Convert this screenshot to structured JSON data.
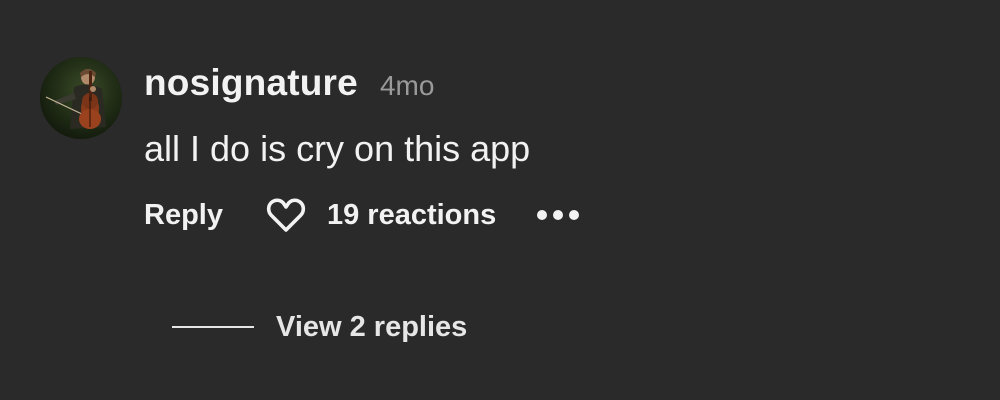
{
  "comment": {
    "avatar_icon": "profile-photo",
    "username": "nosignature",
    "time": "4mo",
    "text": "all I do is cry on this app",
    "reply_label": "Reply",
    "heart_icon": "heart-outline-icon",
    "reactions_label": "19 reactions",
    "more_icon": "ellipsis-icon",
    "view_replies_label": "View 2 replies"
  },
  "colors": {
    "background": "#2a2a2a",
    "primary_text": "#f2f2f2",
    "secondary_text": "#9a9a9a"
  }
}
